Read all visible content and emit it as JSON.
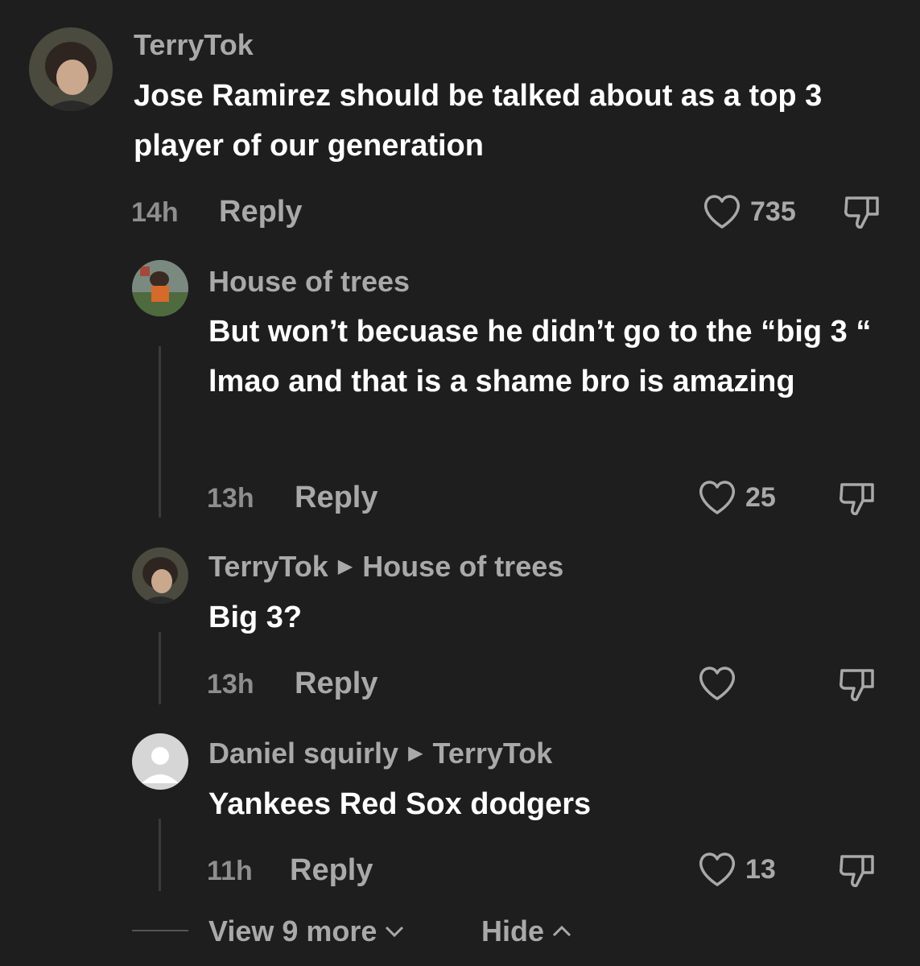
{
  "comments": [
    {
      "username": "TerryTok",
      "text": "Jose Ramirez should be talked about as a top 3 player of our generation",
      "time": "14h",
      "reply_label": "Reply",
      "likes": "735"
    },
    {
      "username": "House of trees",
      "text": "But won’t becuase he didn’t go to the “big 3 “ lmao and that is a shame bro is amazing",
      "time": "13h",
      "reply_label": "Reply",
      "likes": "25"
    },
    {
      "username": "TerryTok",
      "reply_to": "House of trees",
      "text": "Big 3?",
      "time": "13h",
      "reply_label": "Reply",
      "likes": ""
    },
    {
      "username": "Daniel squirly",
      "reply_to": "TerryTok",
      "text": "Yankees Red Sox dodgers",
      "time": "11h",
      "reply_label": "Reply",
      "likes": "13"
    }
  ],
  "footer": {
    "view_more_label": "View 9 more",
    "hide_label": "Hide"
  },
  "icons": {
    "like": "heart-outline-icon",
    "dislike": "thumbs-down-icon",
    "expand": "chevron-down-icon",
    "collapse": "chevron-up-icon",
    "reply_arrow": "caret-right-icon"
  },
  "colors": {
    "background": "#1e1e1e",
    "text": "#ffffff",
    "muted": "#a9a9a9"
  }
}
